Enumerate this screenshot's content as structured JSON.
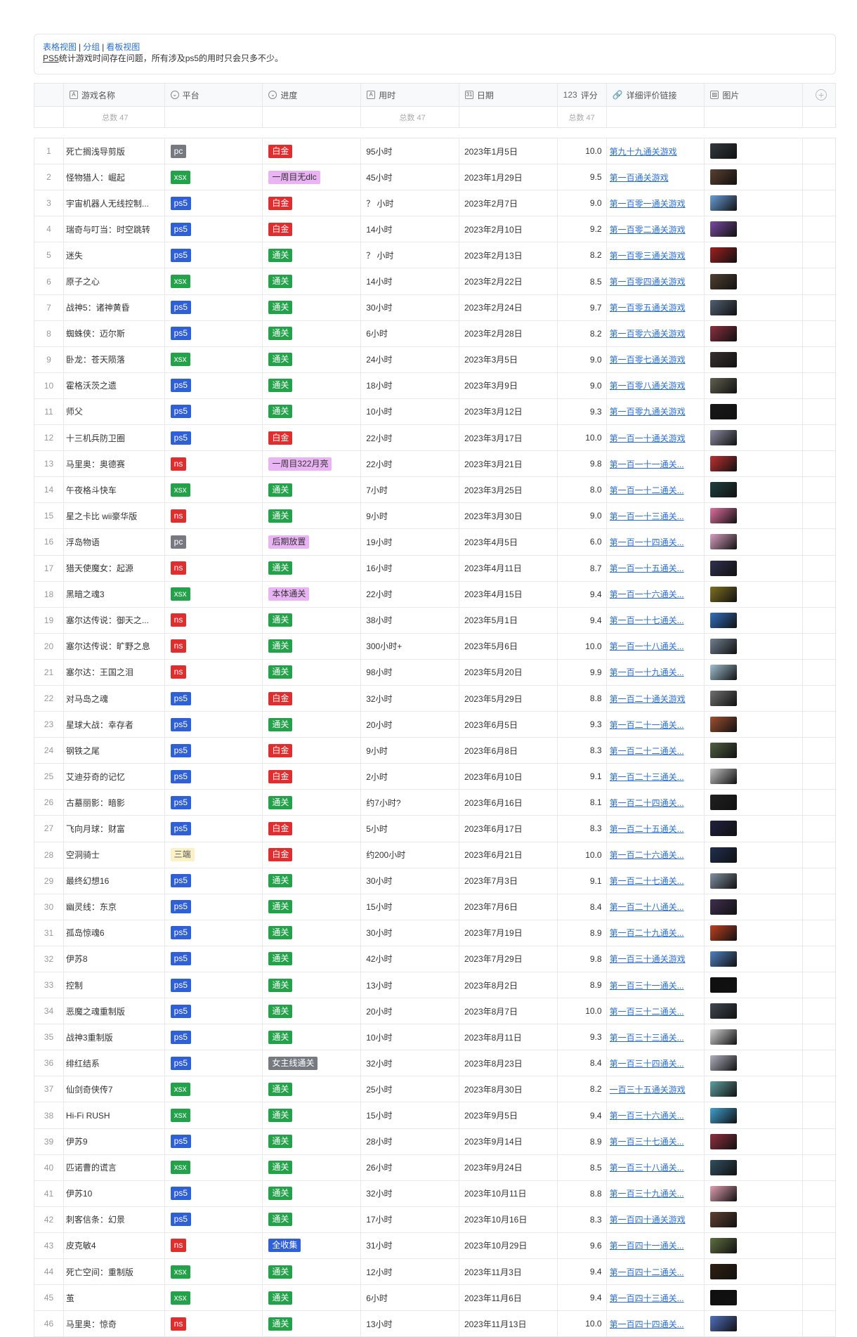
{
  "views": {
    "grid": "表格视图",
    "group": "分组",
    "board": "看板视图",
    "sep": "|"
  },
  "note": {
    "ps5": "PS5",
    "rest": "统计游戏时间存在问题，所有涉及ps5的用时只会只多不少。"
  },
  "columns": {
    "name": "游戏名称",
    "platform": "平台",
    "progress": "进度",
    "time": "用时",
    "date": "日期",
    "score": "评分",
    "score_prefix": "123",
    "link": "详细评价链接",
    "image": "图片"
  },
  "summary": {
    "name": "总数 47",
    "time": "总数 47",
    "score": "总数 47"
  },
  "colors": {
    "pc": "#767a80",
    "xsx": "#22a34a",
    "ps5": "#2f60d8",
    "ns": "#e02d2d",
    "platinum": "#e02d2d",
    "cleared": "#22a34a",
    "pink": "#eab4f4",
    "gray": "#767a80",
    "yellow": "#fbf1c4",
    "fullcollect": "#2f60d8"
  },
  "rows": [
    {
      "n": "1",
      "name": "死亡搁浅导剪版",
      "platform": "pc",
      "progress": "白金",
      "time": "95小时",
      "date": "2023年1月5日",
      "score": "10.0",
      "link": "第九十九通关游戏",
      "img": "#333a40"
    },
    {
      "n": "2",
      "name": "怪物猎人：崛起",
      "platform": "xsx",
      "progress": "一周目无dlc",
      "time": "45小时",
      "date": "2023年1月29日",
      "score": "9.5",
      "link": "第一百通关游戏",
      "img": "#5a4030"
    },
    {
      "n": "3",
      "name": "宇宙机器人无线控制...",
      "platform": "ps5",
      "progress": "白金",
      "time": "？ 小时",
      "date": "2023年2月7日",
      "score": "9.0",
      "link": "第一百零一通关游戏",
      "img": "#6a9ed8"
    },
    {
      "n": "4",
      "name": "瑞奇与叮当：时空跳转",
      "platform": "ps5",
      "progress": "白金",
      "time": "14小时",
      "date": "2023年2月10日",
      "score": "9.2",
      "link": "第一百零二通关游戏",
      "img": "#7a4aa0"
    },
    {
      "n": "5",
      "name": "迷失",
      "platform": "ps5",
      "progress": "通关",
      "time": "？ 小时",
      "date": "2023年2月13日",
      "score": "8.2",
      "link": "第一百零三通关游戏",
      "img": "#a02020"
    },
    {
      "n": "6",
      "name": "原子之心",
      "platform": "xsx",
      "progress": "通关",
      "time": "14小时",
      "date": "2023年2月22日",
      "score": "8.5",
      "link": "第一百零四通关游戏",
      "img": "#504030"
    },
    {
      "n": "7",
      "name": "战神5：诸神黄昏",
      "platform": "ps5",
      "progress": "通关",
      "time": "30小时",
      "date": "2023年2月24日",
      "score": "9.7",
      "link": "第一百零五通关游戏",
      "img": "#506070"
    },
    {
      "n": "8",
      "name": "蜘蛛侠：迈尔斯",
      "platform": "ps5",
      "progress": "通关",
      "time": "6小时",
      "date": "2023年2月28日",
      "score": "8.2",
      "link": "第一百零六通关游戏",
      "img": "#8a3040"
    },
    {
      "n": "9",
      "name": "卧龙：苍天陨落",
      "platform": "xsx",
      "progress": "通关",
      "time": "24小时",
      "date": "2023年3月5日",
      "score": "9.0",
      "link": "第一百零七通关游戏",
      "img": "#3a3030"
    },
    {
      "n": "10",
      "name": "霍格沃茨之遗",
      "platform": "ps5",
      "progress": "通关",
      "time": "18小时",
      "date": "2023年3月9日",
      "score": "9.0",
      "link": "第一百零八通关游戏",
      "img": "#606050"
    },
    {
      "n": "11",
      "name": "师父",
      "platform": "ps5",
      "progress": "通关",
      "time": "10小时",
      "date": "2023年3月12日",
      "score": "9.3",
      "link": "第一百零九通关游戏",
      "img": "#181818"
    },
    {
      "n": "12",
      "name": "十三机兵防卫圈",
      "platform": "ps5",
      "progress": "白金",
      "time": "22小时",
      "date": "2023年3月17日",
      "score": "10.0",
      "link": "第一百一十通关游戏",
      "img": "#8a8aa0"
    },
    {
      "n": "13",
      "name": "马里奥：奥德赛",
      "platform": "ns",
      "progress": "一周目322月亮",
      "time": "22小时",
      "date": "2023年3月21日",
      "score": "9.8",
      "link": "第一百一十一通关...",
      "img": "#c03030"
    },
    {
      "n": "14",
      "name": "午夜格斗快车",
      "platform": "xsx",
      "progress": "通关",
      "time": "7小时",
      "date": "2023年3月25日",
      "score": "8.0",
      "link": "第一百一十二通关...",
      "img": "#204040"
    },
    {
      "n": "15",
      "name": "星之卡比 wii豪华版",
      "platform": "ns",
      "progress": "通关",
      "time": "9小时",
      "date": "2023年3月30日",
      "score": "9.0",
      "link": "第一百一十三通关...",
      "img": "#e070a0"
    },
    {
      "n": "16",
      "name": "浮岛物语",
      "platform": "pc",
      "progress": "后期放置",
      "time": "19小时",
      "date": "2023年4月5日",
      "score": "6.0",
      "link": "第一百一十四通关...",
      "img": "#d8a0c0"
    },
    {
      "n": "17",
      "name": "猎天使魔女：起源",
      "platform": "ns",
      "progress": "通关",
      "time": "16小时",
      "date": "2023年4月11日",
      "score": "8.7",
      "link": "第一百一十五通关...",
      "img": "#303050"
    },
    {
      "n": "18",
      "name": "黑暗之魂3",
      "platform": "xsx",
      "progress": "本体通关",
      "time": "22小时",
      "date": "2023年4月15日",
      "score": "9.4",
      "link": "第一百一十六通关...",
      "img": "#807020"
    },
    {
      "n": "19",
      "name": "塞尔达传说：御天之...",
      "platform": "ns",
      "progress": "通关",
      "time": "38小时",
      "date": "2023年5月1日",
      "score": "9.4",
      "link": "第一百一十七通关...",
      "img": "#3070c0"
    },
    {
      "n": "20",
      "name": "塞尔达传说：旷野之息",
      "platform": "ns",
      "progress": "通关",
      "time": "300小时+",
      "date": "2023年5月6日",
      "score": "10.0",
      "link": "第一百一十八通关...",
      "img": "#708090"
    },
    {
      "n": "21",
      "name": "塞尔达：王国之泪",
      "platform": "ns",
      "progress": "通关",
      "time": "98小时",
      "date": "2023年5月20日",
      "score": "9.9",
      "link": "第一百一十九通关...",
      "img": "#a0c0d0"
    },
    {
      "n": "22",
      "name": "对马岛之魂",
      "platform": "ps5",
      "progress": "白金",
      "time": "32小时",
      "date": "2023年5月29日",
      "score": "8.8",
      "link": "第一百二十通关游戏",
      "img": "#707070"
    },
    {
      "n": "23",
      "name": "星球大战：幸存者",
      "platform": "ps5",
      "progress": "通关",
      "time": "20小时",
      "date": "2023年6月5日",
      "score": "9.3",
      "link": "第一百二十一通关...",
      "img": "#a05030"
    },
    {
      "n": "24",
      "name": "钢铁之尾",
      "platform": "ps5",
      "progress": "白金",
      "time": "9小时",
      "date": "2023年6月8日",
      "score": "8.3",
      "link": "第一百二十二通关...",
      "img": "#506040"
    },
    {
      "n": "25",
      "name": "艾迪芬奇的记忆",
      "platform": "ps5",
      "progress": "白金",
      "time": "2小时",
      "date": "2023年6月10日",
      "score": "9.1",
      "link": "第一百二十三通关...",
      "img": "#c0c0c0"
    },
    {
      "n": "26",
      "name": "古墓丽影：暗影",
      "platform": "ps5",
      "progress": "通关",
      "time": "约7小时?",
      "date": "2023年6月16日",
      "score": "8.1",
      "link": "第一百二十四通关...",
      "img": "#202020"
    },
    {
      "n": "27",
      "name": "飞向月球：财富",
      "platform": "ps5",
      "progress": "白金",
      "time": "5小时",
      "date": "2023年6月17日",
      "score": "8.3",
      "link": "第一百二十五通关...",
      "img": "#202040"
    },
    {
      "n": "28",
      "name": "空洞骑士",
      "platform": "三端",
      "progress": "白金",
      "time": "约200小时",
      "date": "2023年6月21日",
      "score": "10.0",
      "link": "第一百二十六通关...",
      "img": "#203050"
    },
    {
      "n": "29",
      "name": "最终幻想16",
      "platform": "ps5",
      "progress": "通关",
      "time": "30小时",
      "date": "2023年7月3日",
      "score": "9.1",
      "link": "第一百二十七通关...",
      "img": "#8090a0"
    },
    {
      "n": "30",
      "name": "幽灵线：东京",
      "platform": "ps5",
      "progress": "通关",
      "time": "15小时",
      "date": "2023年7月6日",
      "score": "8.4",
      "link": "第一百二十八通关...",
      "img": "#403050"
    },
    {
      "n": "31",
      "name": "孤岛惊魂6",
      "platform": "ps5",
      "progress": "通关",
      "time": "30小时",
      "date": "2023年7月19日",
      "score": "8.9",
      "link": "第一百二十九通关...",
      "img": "#c04020"
    },
    {
      "n": "32",
      "name": "伊苏8",
      "platform": "ps5",
      "progress": "通关",
      "time": "42小时",
      "date": "2023年7月29日",
      "score": "9.8",
      "link": "第一百三十通关游戏",
      "img": "#5080c0"
    },
    {
      "n": "33",
      "name": "控制",
      "platform": "ps5",
      "progress": "通关",
      "time": "13小时",
      "date": "2023年8月2日",
      "score": "8.9",
      "link": "第一百三十一通关...",
      "img": "#101010"
    },
    {
      "n": "34",
      "name": "恶魔之魂重制版",
      "platform": "ps5",
      "progress": "通关",
      "time": "20小时",
      "date": "2023年8月7日",
      "score": "10.0",
      "link": "第一百三十二通关...",
      "img": "#404850"
    },
    {
      "n": "35",
      "name": "战神3重制版",
      "platform": "ps5",
      "progress": "通关",
      "time": "10小时",
      "date": "2023年8月11日",
      "score": "9.3",
      "link": "第一百三十三通关...",
      "img": "#d0d0d0"
    },
    {
      "n": "36",
      "name": "绯红结系",
      "platform": "ps5",
      "progress": "女主线通关",
      "time": "32小时",
      "date": "2023年8月23日",
      "score": "8.4",
      "link": "第一百三十四通关...",
      "img": "#b0b0c0"
    },
    {
      "n": "37",
      "name": "仙剑奇侠传7",
      "platform": "xsx",
      "progress": "通关",
      "time": "25小时",
      "date": "2023年8月30日",
      "score": "8.2",
      "link": "一百三十五通关游戏",
      "img": "#60a0a0"
    },
    {
      "n": "38",
      "name": "Hi-Fi RUSH",
      "platform": "xsx",
      "progress": "通关",
      "time": "15小时",
      "date": "2023年9月5日",
      "score": "9.4",
      "link": "第一百三十六通关...",
      "img": "#40a0d0"
    },
    {
      "n": "39",
      "name": "伊苏9",
      "platform": "ps5",
      "progress": "通关",
      "time": "28小时",
      "date": "2023年9月14日",
      "score": "8.9",
      "link": "第一百三十七通关...",
      "img": "#903040"
    },
    {
      "n": "40",
      "name": "匹诺曹的谎言",
      "platform": "xsx",
      "progress": "通关",
      "time": "26小时",
      "date": "2023年9月24日",
      "score": "8.5",
      "link": "第一百三十八通关...",
      "img": "#305060"
    },
    {
      "n": "41",
      "name": "伊苏10",
      "platform": "ps5",
      "progress": "通关",
      "time": "32小时",
      "date": "2023年10月11日",
      "score": "8.8",
      "link": "第一百三十九通关...",
      "img": "#e0a0b0"
    },
    {
      "n": "42",
      "name": "刺客信条：幻景",
      "platform": "ps5",
      "progress": "通关",
      "time": "17小时",
      "date": "2023年10月16日",
      "score": "8.3",
      "link": "第一百四十通关游戏",
      "img": "#604030"
    },
    {
      "n": "43",
      "name": "皮克敏4",
      "platform": "ns",
      "progress": "全收集",
      "time": "31小时",
      "date": "2023年10月29日",
      "score": "9.6",
      "link": "第一百四十一通关...",
      "img": "#607040"
    },
    {
      "n": "44",
      "name": "死亡空间：重制版",
      "platform": "xsx",
      "progress": "通关",
      "time": "12小时",
      "date": "2023年11月3日",
      "score": "9.4",
      "link": "第一百四十二通关...",
      "img": "#302010"
    },
    {
      "n": "45",
      "name": "茧",
      "platform": "xsx",
      "progress": "通关",
      "time": "6小时",
      "date": "2023年11月6日",
      "score": "9.4",
      "link": "第一百四十三通关...",
      "img": "#101010"
    },
    {
      "n": "46",
      "name": "马里奥：惊奇",
      "platform": "ns",
      "progress": "通关",
      "time": "13小时",
      "date": "2023年11月13日",
      "score": "10.0",
      "link": "第一百四十四通关...",
      "img": "#5070c0"
    }
  ]
}
